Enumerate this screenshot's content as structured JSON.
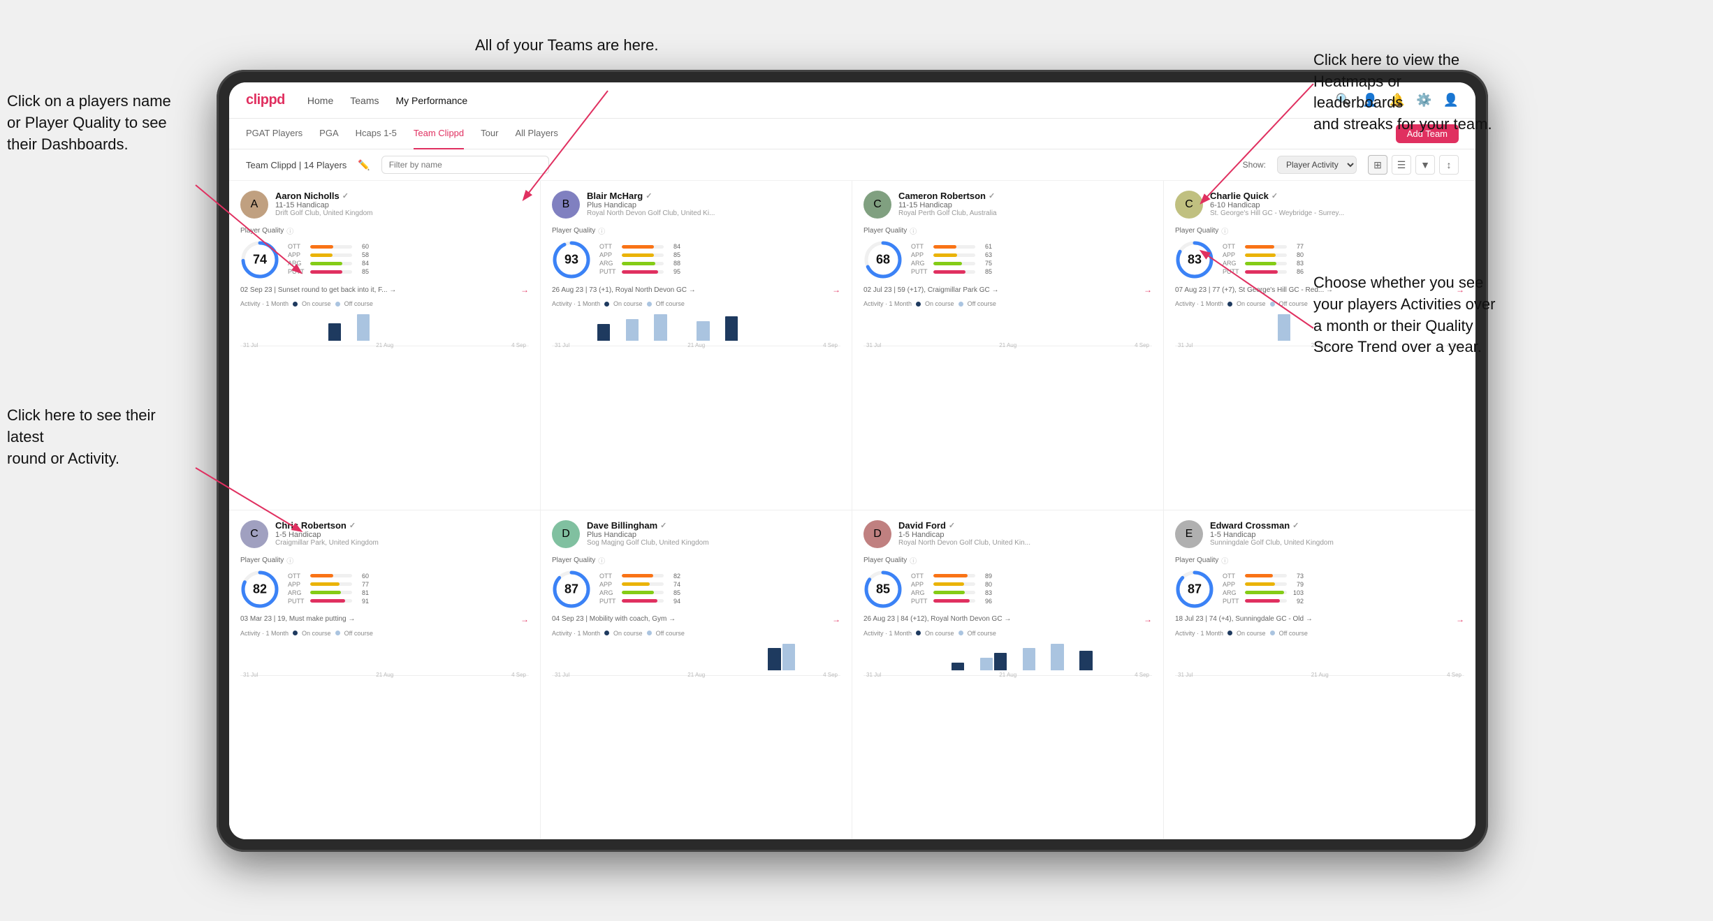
{
  "annotations": {
    "click_name": "Click on a players name\nor Player Quality to see\ntheir Dashboards.",
    "teams_here": "All of your Teams are here.",
    "heatmaps": "Click here to view the\nHeatmaps or leaderboards\nand streaks for your team.",
    "latest_round": "Click here to see their latest\nround or Activity.",
    "activities": "Choose whether you see\nyour players Activities over\na month or their Quality\nScore Trend over a year."
  },
  "nav": {
    "logo": "clippd",
    "items": [
      "Home",
      "Teams",
      "My Performance"
    ],
    "active": "Teams"
  },
  "sub_nav": {
    "items": [
      "PGAT Players",
      "PGA",
      "Hcaps 1-5",
      "Team Clippd",
      "Tour",
      "All Players"
    ],
    "active": "Team Clippd"
  },
  "team_bar": {
    "label": "Team Clippd | 14 Players",
    "search_placeholder": "Filter by name",
    "show_label": "Show:",
    "show_value": "Player Activity",
    "add_team": "Add Team"
  },
  "players": [
    {
      "name": "Aaron Nicholls",
      "handicap": "11-15 Handicap",
      "club": "Drift Golf Club, United Kingdom",
      "score": 74,
      "score_color": "#3b82f6",
      "stats": [
        {
          "label": "OTT",
          "value": 60,
          "color": "#f97316"
        },
        {
          "label": "APP",
          "value": 58,
          "color": "#eab308"
        },
        {
          "label": "ARG",
          "value": 84,
          "color": "#84cc16"
        },
        {
          "label": "PUTT",
          "value": 85,
          "color": "#e03060"
        }
      ],
      "latest": "02 Sep 23 | Sunset round to get back into it, F... →",
      "activity_dates": [
        "31 Jul",
        "21 Aug",
        "4 Sep"
      ],
      "bars": [
        0,
        0,
        0,
        0,
        0,
        0,
        12,
        0,
        18,
        0,
        0,
        0,
        0,
        0,
        0,
        0,
        0,
        0,
        0,
        0
      ],
      "avatar_color": "#c0a080",
      "avatar_letter": "A"
    },
    {
      "name": "Blair McHarg",
      "handicap": "Plus Handicap",
      "club": "Royal North Devon Golf Club, United Ki...",
      "score": 93,
      "score_color": "#3b82f6",
      "stats": [
        {
          "label": "OTT",
          "value": 84,
          "color": "#f97316"
        },
        {
          "label": "APP",
          "value": 85,
          "color": "#eab308"
        },
        {
          "label": "ARG",
          "value": 88,
          "color": "#84cc16"
        },
        {
          "label": "PUTT",
          "value": 95,
          "color": "#e03060"
        }
      ],
      "latest": "26 Aug 23 | 73 (+1), Royal North Devon GC →",
      "activity_dates": [
        "31 Jul",
        "21 Aug",
        "4 Sep"
      ],
      "bars": [
        0,
        0,
        0,
        14,
        0,
        18,
        0,
        22,
        0,
        0,
        16,
        0,
        20,
        0,
        0,
        0,
        0,
        0,
        0,
        0
      ],
      "avatar_color": "#8080c0",
      "avatar_letter": "B"
    },
    {
      "name": "Cameron Robertson",
      "handicap": "11-15 Handicap",
      "club": "Royal Perth Golf Club, Australia",
      "score": 68,
      "score_color": "#3b82f6",
      "stats": [
        {
          "label": "OTT",
          "value": 61,
          "color": "#f97316"
        },
        {
          "label": "APP",
          "value": 63,
          "color": "#eab308"
        },
        {
          "label": "ARG",
          "value": 75,
          "color": "#84cc16"
        },
        {
          "label": "PUTT",
          "value": 85,
          "color": "#e03060"
        }
      ],
      "latest": "02 Jul 23 | 59 (+17), Craigmillar Park GC →",
      "activity_dates": [
        "31 Jul",
        "21 Aug",
        "4 Sep"
      ],
      "bars": [
        0,
        0,
        0,
        0,
        0,
        0,
        0,
        0,
        0,
        0,
        0,
        0,
        0,
        0,
        0,
        0,
        0,
        0,
        0,
        0
      ],
      "avatar_color": "#80a080",
      "avatar_letter": "C"
    },
    {
      "name": "Charlie Quick",
      "handicap": "6-10 Handicap",
      "club": "St. George's Hill GC - Weybridge - Surrey...",
      "score": 83,
      "score_color": "#3b82f6",
      "stats": [
        {
          "label": "OTT",
          "value": 77,
          "color": "#f97316"
        },
        {
          "label": "APP",
          "value": 80,
          "color": "#eab308"
        },
        {
          "label": "ARG",
          "value": 83,
          "color": "#84cc16"
        },
        {
          "label": "PUTT",
          "value": 86,
          "color": "#e03060"
        }
      ],
      "latest": "07 Aug 23 | 77 (+7), St George's Hill GC - Red... →",
      "activity_dates": [
        "31 Jul",
        "21 Aug",
        "4 Sep"
      ],
      "bars": [
        0,
        0,
        0,
        0,
        0,
        0,
        0,
        10,
        0,
        0,
        0,
        0,
        0,
        0,
        0,
        0,
        0,
        0,
        0,
        0
      ],
      "avatar_color": "#c0c080",
      "avatar_letter": "C"
    },
    {
      "name": "Chris Robertson",
      "handicap": "1-5 Handicap",
      "club": "Craigmillar Park, United Kingdom",
      "score": 82,
      "score_color": "#3b82f6",
      "stats": [
        {
          "label": "OTT",
          "value": 60,
          "color": "#f97316"
        },
        {
          "label": "APP",
          "value": 77,
          "color": "#eab308"
        },
        {
          "label": "ARG",
          "value": 81,
          "color": "#84cc16"
        },
        {
          "label": "PUTT",
          "value": 91,
          "color": "#e03060"
        }
      ],
      "latest": "03 Mar 23 | 19, Must make putting →",
      "activity_dates": [
        "31 Jul",
        "21 Aug",
        "4 Sep"
      ],
      "bars": [
        0,
        0,
        0,
        0,
        0,
        0,
        0,
        0,
        0,
        0,
        0,
        0,
        0,
        0,
        0,
        0,
        0,
        0,
        0,
        0
      ],
      "avatar_color": "#a0a0c0",
      "avatar_letter": "C"
    },
    {
      "name": "Dave Billingham",
      "handicap": "Plus Handicap",
      "club": "Sog Magjng Golf Club, United Kingdom",
      "score": 87,
      "score_color": "#3b82f6",
      "stats": [
        {
          "label": "OTT",
          "value": 82,
          "color": "#f97316"
        },
        {
          "label": "APP",
          "value": 74,
          "color": "#eab308"
        },
        {
          "label": "ARG",
          "value": 85,
          "color": "#84cc16"
        },
        {
          "label": "PUTT",
          "value": 94,
          "color": "#e03060"
        }
      ],
      "latest": "04 Sep 23 | Mobility with coach, Gym →",
      "activity_dates": [
        "31 Jul",
        "21 Aug",
        "4 Sep"
      ],
      "bars": [
        0,
        0,
        0,
        0,
        0,
        0,
        0,
        0,
        0,
        0,
        0,
        0,
        0,
        0,
        0,
        10,
        12,
        0,
        0,
        0
      ],
      "avatar_color": "#80c0a0",
      "avatar_letter": "D"
    },
    {
      "name": "David Ford",
      "handicap": "1-5 Handicap",
      "club": "Royal North Devon Golf Club, United Kin...",
      "score": 85,
      "score_color": "#3b82f6",
      "stats": [
        {
          "label": "OTT",
          "value": 89,
          "color": "#f97316"
        },
        {
          "label": "APP",
          "value": 80,
          "color": "#eab308"
        },
        {
          "label": "ARG",
          "value": 83,
          "color": "#84cc16"
        },
        {
          "label": "PUTT",
          "value": 96,
          "color": "#e03060"
        }
      ],
      "latest": "26 Aug 23 | 84 (+12), Royal North Devon GC →",
      "activity_dates": [
        "31 Jul",
        "21 Aug",
        "4 Sep"
      ],
      "bars": [
        0,
        0,
        0,
        0,
        0,
        0,
        6,
        0,
        10,
        14,
        0,
        18,
        0,
        22,
        0,
        16,
        0,
        0,
        0,
        0
      ],
      "avatar_color": "#c08080",
      "avatar_letter": "D"
    },
    {
      "name": "Edward Crossman",
      "handicap": "1-5 Handicap",
      "club": "Sunningdale Golf Club, United Kingdom",
      "score": 87,
      "score_color": "#3b82f6",
      "stats": [
        {
          "label": "OTT",
          "value": 73,
          "color": "#f97316"
        },
        {
          "label": "APP",
          "value": 79,
          "color": "#eab308"
        },
        {
          "label": "ARG",
          "value": 103,
          "color": "#84cc16"
        },
        {
          "label": "PUTT",
          "value": 92,
          "color": "#e03060"
        }
      ],
      "latest": "18 Jul 23 | 74 (+4), Sunningdale GC - Old →",
      "activity_dates": [
        "31 Jul",
        "21 Aug",
        "4 Sep"
      ],
      "bars": [
        0,
        0,
        0,
        0,
        0,
        0,
        0,
        0,
        0,
        0,
        0,
        0,
        0,
        0,
        0,
        0,
        0,
        0,
        0,
        0
      ],
      "avatar_color": "#b0b0b0",
      "avatar_letter": "E"
    }
  ],
  "activity": {
    "label": "Activity · 1 Month",
    "on_course": "On course",
    "off_course": "Off course",
    "on_color": "#1e3a5f",
    "off_color": "#aac4e0"
  }
}
